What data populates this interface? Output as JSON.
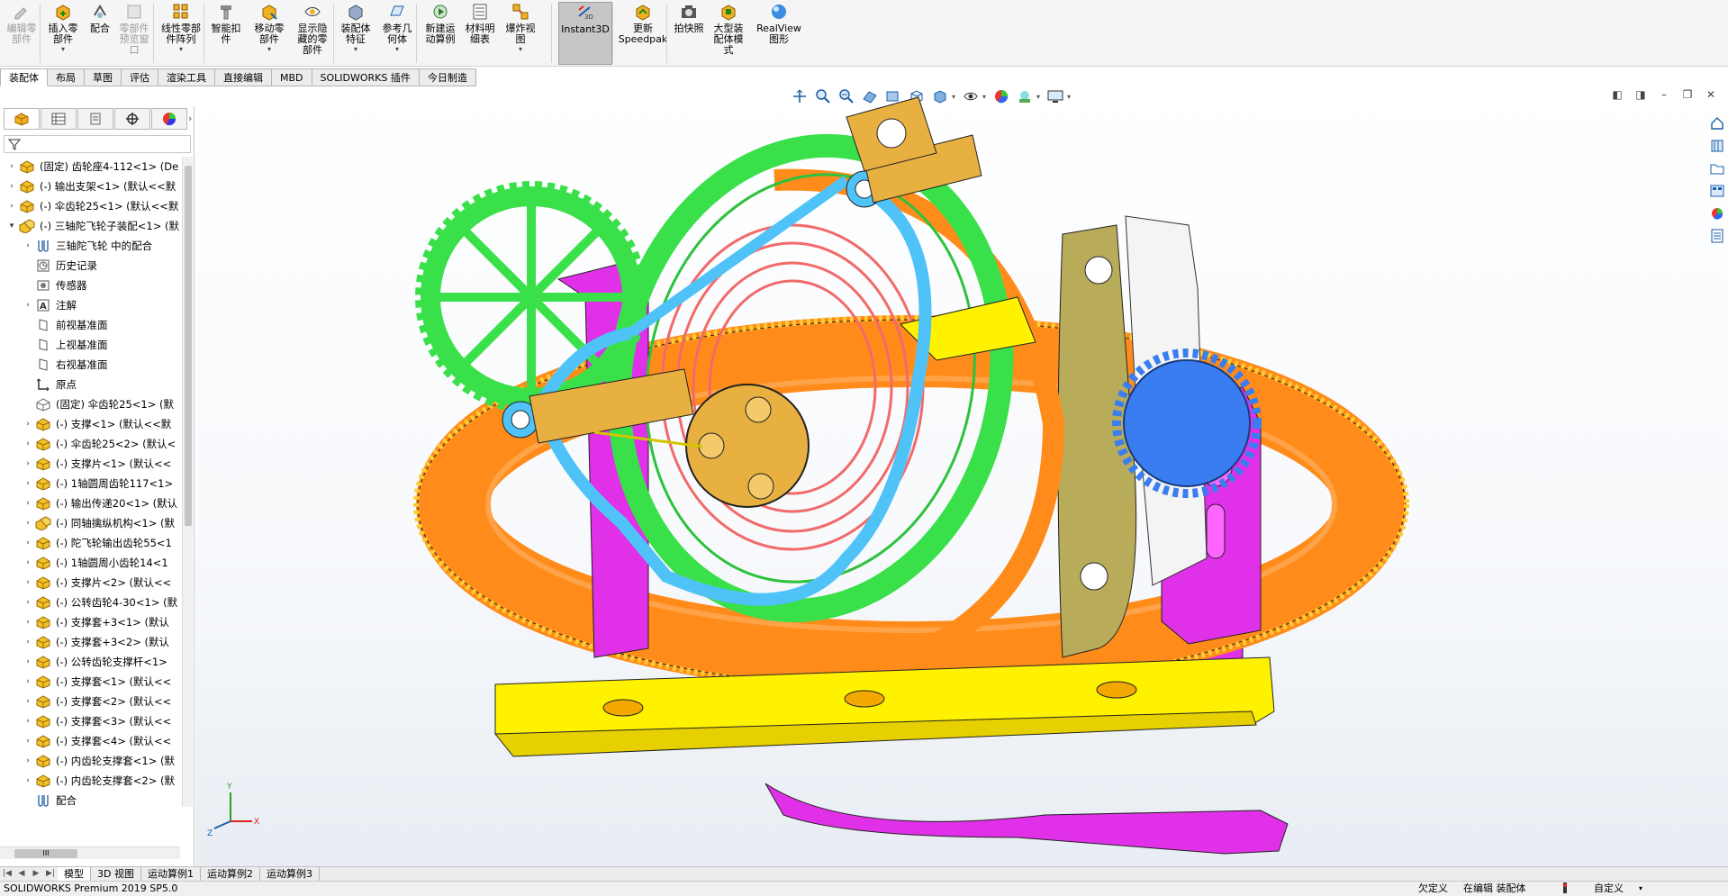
{
  "ribbon": {
    "buttons": [
      {
        "label": "编辑零\n部件",
        "icon": "edit-component-icon",
        "disabled": true
      },
      {
        "label": "插入零\n部件",
        "icon": "insert-component-icon",
        "dropdown": true
      },
      {
        "label": "配合",
        "icon": "mate-icon"
      },
      {
        "label": "零部件\n预览窗\n口",
        "icon": "component-preview-icon",
        "disabled": true
      },
      {
        "label": "线性零部\n件阵列",
        "icon": "linear-pattern-icon",
        "dropdown": true
      },
      {
        "label": "智能扣\n件",
        "icon": "smart-fasteners-icon"
      },
      {
        "label": "移动零\n部件",
        "icon": "move-component-icon",
        "dropdown": true
      },
      {
        "label": "显示隐\n藏的零\n部件",
        "icon": "show-hidden-components-icon"
      },
      {
        "label": "装配体\n特征",
        "icon": "assembly-features-icon",
        "dropdown": true
      },
      {
        "label": "参考几\n何体",
        "icon": "reference-geometry-icon",
        "dropdown": true
      },
      {
        "label": "新建运\n动算例",
        "icon": "new-motion-study-icon"
      },
      {
        "label": "材料明\n细表",
        "icon": "bill-of-materials-icon"
      },
      {
        "label": "爆炸视\n图",
        "icon": "exploded-view-icon",
        "dropdown": true
      },
      {
        "label": "Instant3D",
        "icon": "instant3d-icon",
        "active": true
      },
      {
        "label": "更新\nSpeedpak",
        "icon": "speedpak-icon"
      },
      {
        "label": "拍快照",
        "icon": "snapshot-icon"
      },
      {
        "label": "大型装\n配体模\n式",
        "icon": "large-assembly-mode-icon"
      },
      {
        "label": "RealView\n图形",
        "icon": "realview-icon"
      }
    ]
  },
  "tabs": [
    "装配体",
    "布局",
    "草图",
    "评估",
    "渲染工具",
    "直接编辑",
    "MBD",
    "SOLIDWORKS 插件",
    "今日制造"
  ],
  "tree": [
    {
      "text": "(固定) 齿轮座4-112<1> (De",
      "level": 0,
      "icon": "part",
      "expand": true
    },
    {
      "text": "(-) 输出支架<1> (默认<<默",
      "level": 0,
      "icon": "part",
      "expand": true
    },
    {
      "text": "(-) 伞齿轮25<1> (默认<<默",
      "level": 0,
      "icon": "part",
      "expand": true
    },
    {
      "text": "(-) 三轴陀飞轮子装配<1> (默",
      "level": 0,
      "icon": "subassembly",
      "expand": true,
      "open": true
    },
    {
      "text": "三轴陀飞轮 中的配合",
      "level": 1,
      "icon": "mates",
      "expand": true
    },
    {
      "text": "历史记录",
      "level": 1,
      "icon": "history"
    },
    {
      "text": "传感器",
      "level": 1,
      "icon": "sensor"
    },
    {
      "text": "注解",
      "level": 1,
      "icon": "annotation",
      "expand": true
    },
    {
      "text": "前视基准面",
      "level": 1,
      "icon": "plane"
    },
    {
      "text": "上视基准面",
      "level": 1,
      "icon": "plane"
    },
    {
      "text": "右视基准面",
      "level": 1,
      "icon": "plane"
    },
    {
      "text": "原点",
      "level": 1,
      "icon": "origin"
    },
    {
      "text": "(固定) 伞齿轮25<1> (默",
      "level": 1,
      "icon": "part-outline"
    },
    {
      "text": "(-) 支撑<1> (默认<<默",
      "level": 1,
      "icon": "part",
      "expand": true
    },
    {
      "text": "(-) 伞齿轮25<2> (默认<",
      "level": 1,
      "icon": "part",
      "expand": true
    },
    {
      "text": "(-) 支撑片<1> (默认<<",
      "level": 1,
      "icon": "part",
      "expand": true
    },
    {
      "text": "(-) 1轴圆周齿轮117<1>",
      "level": 1,
      "icon": "part",
      "expand": true
    },
    {
      "text": "(-) 输出传递20<1> (默认",
      "level": 1,
      "icon": "part",
      "expand": true
    },
    {
      "text": "(-) 同轴擒纵机构<1> (默",
      "level": 1,
      "icon": "subassembly",
      "expand": true
    },
    {
      "text": "(-) 陀飞轮输出齿轮55<1",
      "level": 1,
      "icon": "part",
      "expand": true
    },
    {
      "text": "(-) 1轴圆周小齿轮14<1",
      "level": 1,
      "icon": "part",
      "expand": true
    },
    {
      "text": "(-) 支撑片<2> (默认<<",
      "level": 1,
      "icon": "part",
      "expand": true
    },
    {
      "text": "(-) 公转齿轮4-30<1> (默",
      "level": 1,
      "icon": "part",
      "expand": true
    },
    {
      "text": "(-) 支撑套+3<1> (默认",
      "level": 1,
      "icon": "part",
      "expand": true
    },
    {
      "text": "(-) 支撑套+3<2> (默认",
      "level": 1,
      "icon": "part",
      "expand": true
    },
    {
      "text": "(-) 公转齿轮支撑杆<1>",
      "level": 1,
      "icon": "part",
      "expand": true
    },
    {
      "text": "(-) 支撑套<1> (默认<<",
      "level": 1,
      "icon": "part",
      "expand": true
    },
    {
      "text": "(-) 支撑套<2> (默认<<",
      "level": 1,
      "icon": "part",
      "expand": true
    },
    {
      "text": "(-) 支撑套<3> (默认<<",
      "level": 1,
      "icon": "part",
      "expand": true
    },
    {
      "text": "(-) 支撑套<4> (默认<<",
      "level": 1,
      "icon": "part",
      "expand": true
    },
    {
      "text": "(-) 内齿轮支撑套<1> (默",
      "level": 1,
      "icon": "part",
      "expand": true
    },
    {
      "text": "(-) 内齿轮支撑套<2> (默",
      "level": 1,
      "icon": "part",
      "expand": true
    },
    {
      "text": "配合",
      "level": 1,
      "icon": "mates"
    },
    {
      "text": "配合",
      "level": 0,
      "icon": "mates",
      "expand": true
    }
  ],
  "hscroll_label": "III",
  "bottom_tabs": [
    "模型",
    "3D 视图",
    "运动算例1",
    "运动算例2",
    "运动算例3"
  ],
  "status": {
    "app": "SOLIDWORKS Premium 2019 SP5.0",
    "definition": "欠定义",
    "editing": "在编辑 装配体",
    "custom": "自定义"
  },
  "colors": {
    "ribbon_bg": "#f5f5f5",
    "gear_orange": "#ff8c1a",
    "gear_green": "#39e04a",
    "gear_blue": "#3a7df0",
    "magenta": "#e030e8",
    "yellow": "#fff200",
    "cyan": "#4fc3f7",
    "bronze": "#e8b040",
    "olive": "#b8ac5a"
  }
}
